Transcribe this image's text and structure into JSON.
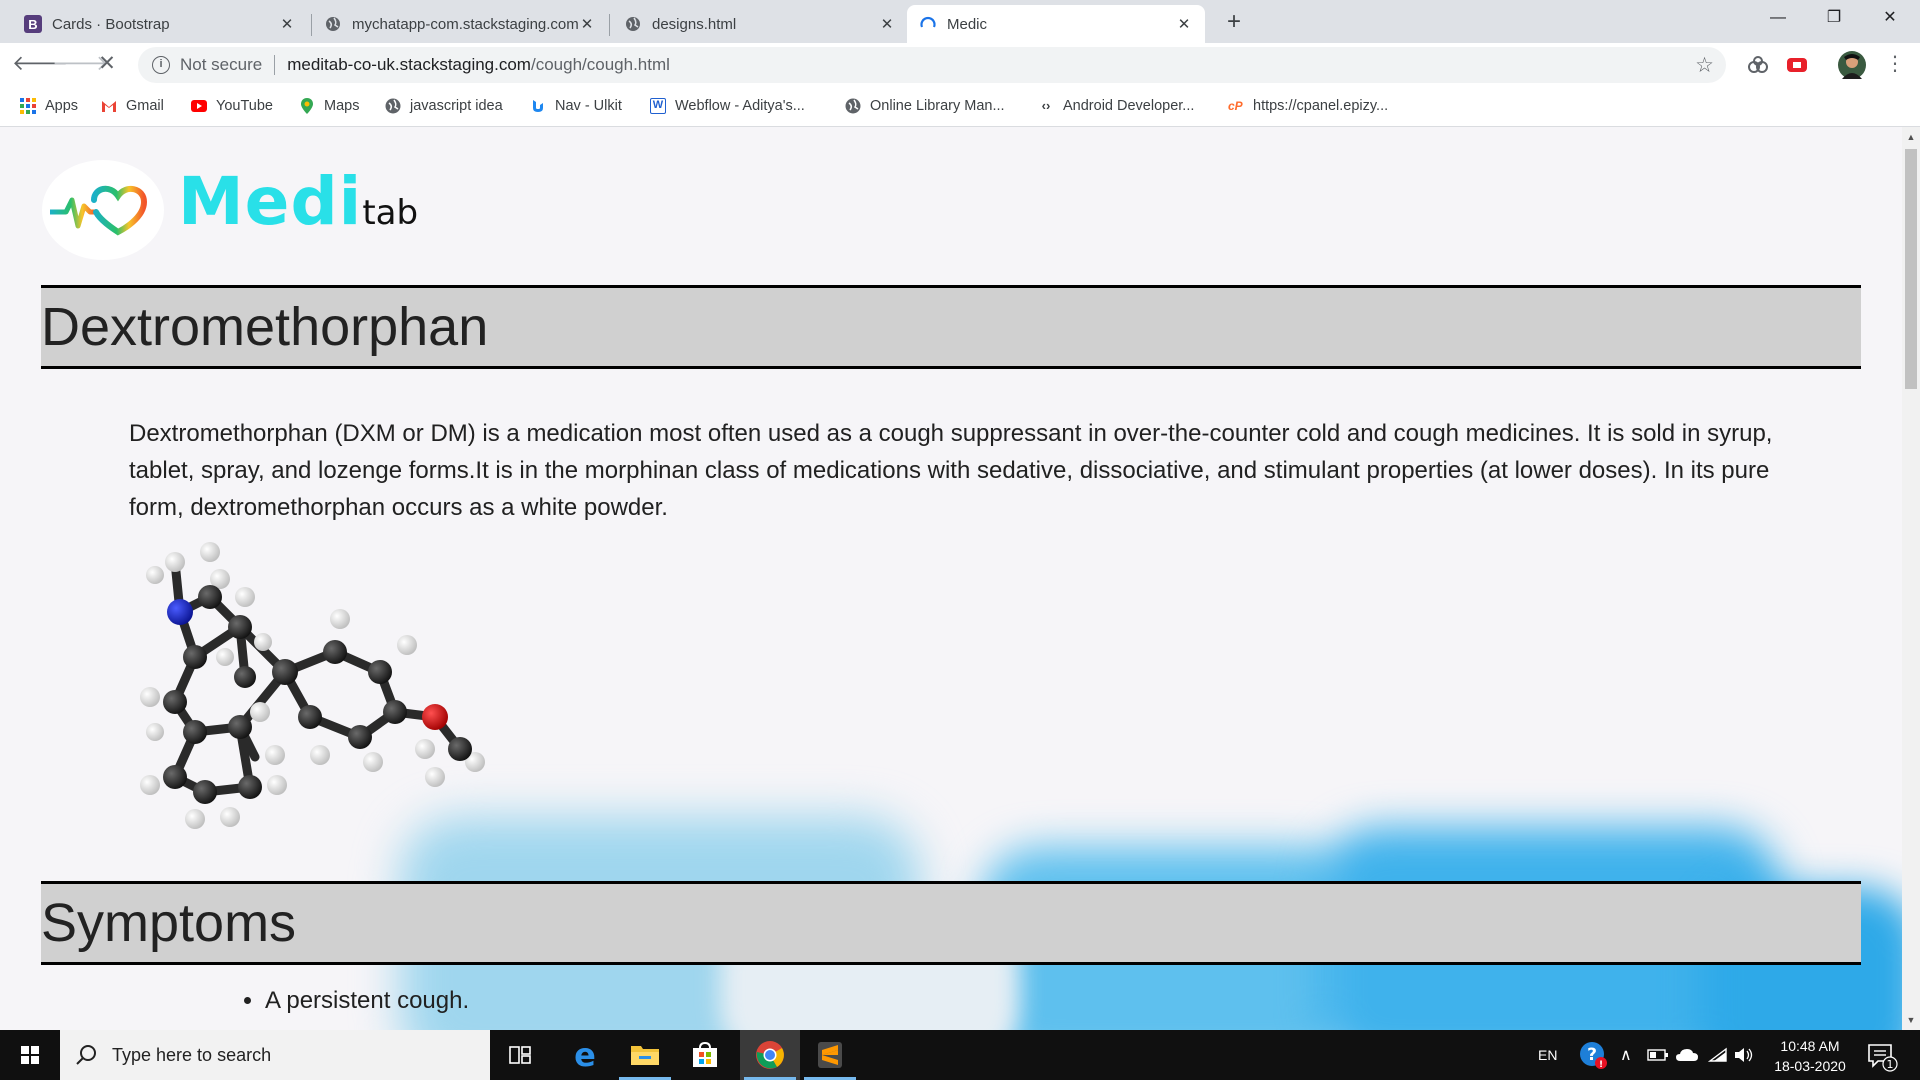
{
  "browser": {
    "tabs": [
      {
        "title": "Cards · Bootstrap",
        "icon": "bootstrap-icon"
      },
      {
        "title": "mychatapp-com.stackstaging.com",
        "icon": "globe-icon"
      },
      {
        "title": "designs.html",
        "icon": "globe-icon"
      },
      {
        "title": "Medic",
        "icon": "loading-icon",
        "active": true
      }
    ],
    "address": {
      "security": "Not secure",
      "host": "meditab-co-uk.stackstaging.com",
      "path": "/cough/cough.html"
    },
    "bookmarks": [
      {
        "label": "Apps",
        "icon": "apps-grid-icon"
      },
      {
        "label": "Gmail",
        "icon": "gmail-icon"
      },
      {
        "label": "YouTube",
        "icon": "youtube-icon"
      },
      {
        "label": "Maps",
        "icon": "maps-pin-icon"
      },
      {
        "label": "javascript idea",
        "icon": "globe-icon"
      },
      {
        "label": "Nav - Ulkit",
        "icon": "uikit-icon"
      },
      {
        "label": "Webflow - Aditya's...",
        "icon": "webflow-icon"
      },
      {
        "label": "Online Library Man...",
        "icon": "globe-icon"
      },
      {
        "label": "Android Developer...",
        "icon": "code-icon"
      },
      {
        "label": "https://cpanel.epizy...",
        "icon": "cpanel-icon"
      }
    ]
  },
  "page": {
    "brand": {
      "main": "Medi",
      "suffix": "tab"
    },
    "drug_heading": "Dextromethorphan",
    "description": "Dextromethorphan (DXM or DM) is a medication most often used as a cough suppressant in over-the-counter cold and cough medicines. It is sold in syrup, tablet, spray, and lozenge forms.It is in the morphinan class of medications with sedative, dissociative, and stimulant properties (at lower doses). In its pure form, dextromethorphan occurs as a white powder.",
    "symptoms_heading": "Symptoms",
    "symptoms": [
      "A persistent cough."
    ]
  },
  "taskbar": {
    "search_placeholder": "Type here to search",
    "language": "EN",
    "time": "10:48 AM",
    "date": "18-03-2020",
    "notification_count": "1"
  },
  "colors": {
    "brand_cyan": "#29e0e8",
    "heading_band": "#d0d0d0",
    "tab_strip": "#dee1e6"
  }
}
